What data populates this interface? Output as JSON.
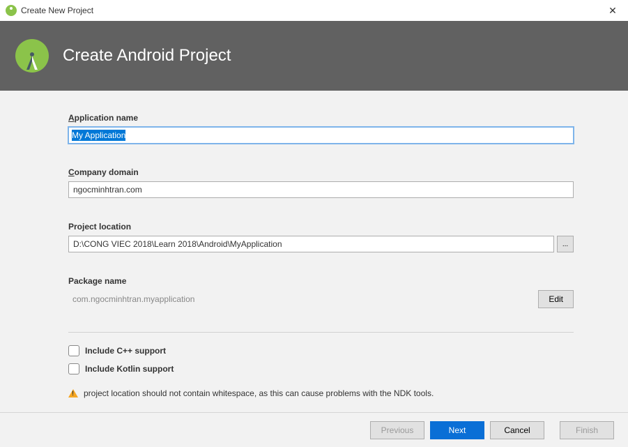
{
  "window": {
    "title": "Create New Project"
  },
  "header": {
    "title": "Create Android Project"
  },
  "fields": {
    "app_name": {
      "label": "Application name",
      "value": "My Application"
    },
    "company_domain": {
      "label": "Company domain",
      "value": "ngocminhtran.com"
    },
    "project_location": {
      "label": "Project location",
      "value": "D:\\CONG VIEC 2018\\Learn 2018\\Android\\MyApplication",
      "browse": "..."
    },
    "package_name": {
      "label": "Package name",
      "value": "com.ngocminhtran.myapplication",
      "edit": "Edit"
    }
  },
  "options": {
    "cpp": "Include C++ support",
    "kotlin": "Include Kotlin support"
  },
  "warning": "project location should not contain whitespace, as this can cause problems with the NDK tools.",
  "buttons": {
    "previous": "Previous",
    "next": "Next",
    "cancel": "Cancel",
    "finish": "Finish"
  }
}
